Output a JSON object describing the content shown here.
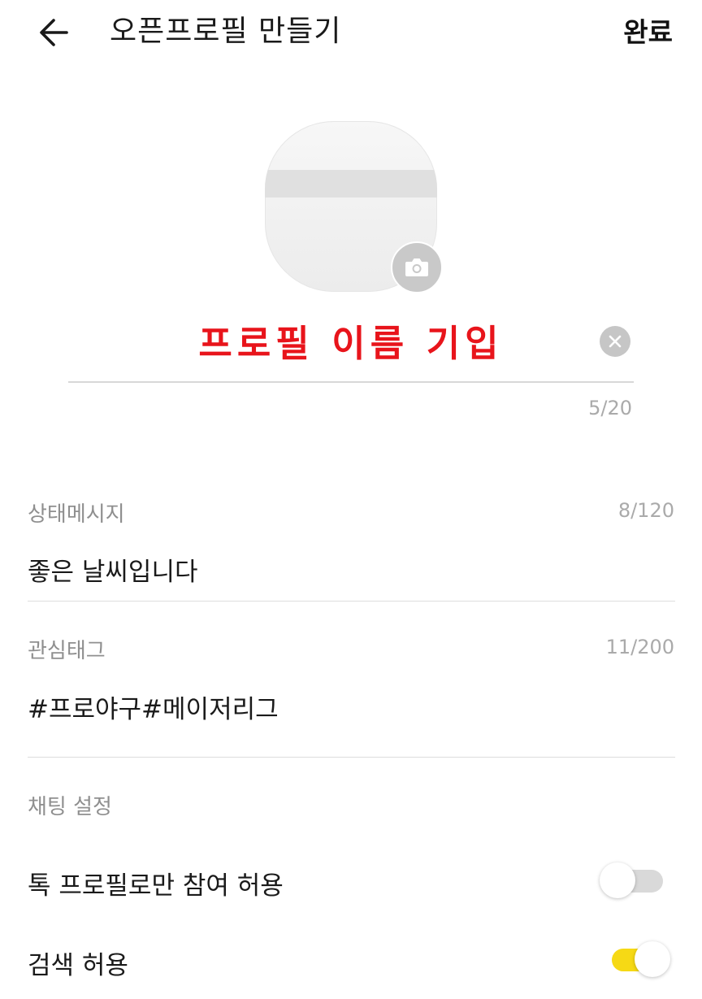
{
  "header": {
    "back_icon": "arrow-left-icon",
    "title": "오픈프로필 만들기",
    "done_label": "완료"
  },
  "profile": {
    "camera_icon": "camera-icon",
    "name_value": "프로필 이름 기입",
    "name_count": "5/20",
    "clear_icon": "close-circle-icon",
    "name_color": "#e8141b"
  },
  "status_message": {
    "label": "상태메시지",
    "count": "8/120",
    "value": "좋은 날씨입니다"
  },
  "interest_tags": {
    "label": "관심태그",
    "count": "11/200",
    "value": "#프로야구#메이저리그"
  },
  "chat_settings": {
    "section_label": "채팅 설정",
    "items": [
      {
        "label": "톡 프로필로만 참여 허용",
        "enabled": false
      },
      {
        "label": "검색 허용",
        "enabled": true
      }
    ],
    "toggle_on_color": "#f6d915",
    "toggle_off_color": "#d9d9d9"
  }
}
